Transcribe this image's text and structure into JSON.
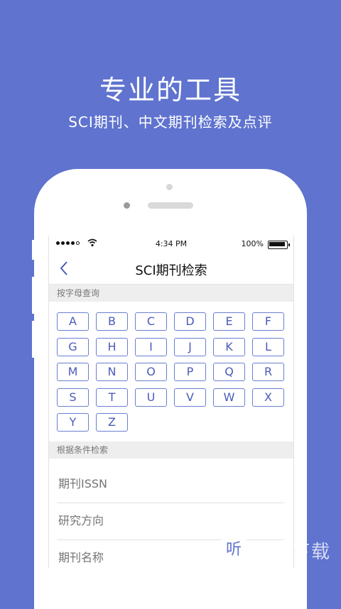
{
  "hero": {
    "title": "专业的工具",
    "subtitle": "SCI期刊、中文期刊检索及点评"
  },
  "status_bar": {
    "time": "4:34 PM",
    "battery": "100%"
  },
  "nav": {
    "title": "SCI期刊检索"
  },
  "letter_section": {
    "header": "按字母查询",
    "letters": [
      "A",
      "B",
      "C",
      "D",
      "E",
      "F",
      "G",
      "H",
      "I",
      "J",
      "K",
      "L",
      "M",
      "N",
      "O",
      "P",
      "Q",
      "R",
      "S",
      "T",
      "U",
      "V",
      "W",
      "X",
      "Y",
      "Z"
    ]
  },
  "condition_section": {
    "header": "根据条件检索",
    "fields": [
      {
        "placeholder": "期刊ISSN"
      },
      {
        "placeholder": "研究方向"
      },
      {
        "placeholder": "期刊名称"
      }
    ]
  },
  "watermark": {
    "icon_char": "听",
    "text": "一听下载"
  },
  "colors": {
    "background": "#5f73cf",
    "accent": "#4b5bb8"
  }
}
